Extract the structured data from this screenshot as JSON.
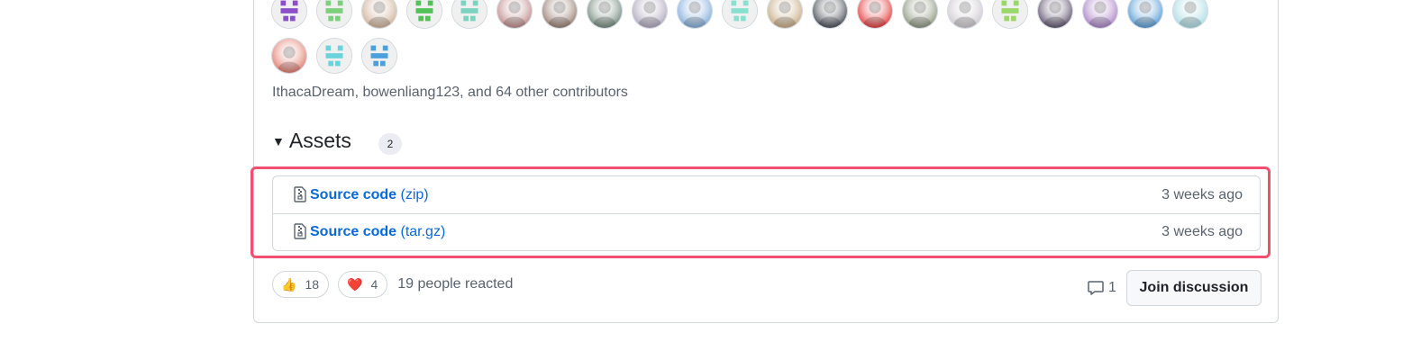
{
  "contributors": {
    "text": "IthacaDream, bowenliang123, and 64 other contributors",
    "avatars": [
      {
        "label": "purple-identicon",
        "color": "#8a4fc9"
      },
      {
        "label": "green-identicon",
        "color": "#7bd17b"
      },
      {
        "label": "photo-avatar",
        "color": "#c9a78a"
      },
      {
        "label": "green-identicon",
        "color": "#52c158"
      },
      {
        "label": "teal-identicon",
        "color": "#7cd3c0"
      },
      {
        "label": "photo-avatar",
        "color": "#b87a7a"
      },
      {
        "label": "photo-avatar",
        "color": "#8b6c5c"
      },
      {
        "label": "photo-avatar",
        "color": "#5f7a6a"
      },
      {
        "label": "photo-avatar",
        "color": "#a59bb5"
      },
      {
        "label": "cartoon-avatar",
        "color": "#6fa1d6"
      },
      {
        "label": "teal-identicon",
        "color": "#8ae0d0"
      },
      {
        "label": "cat-avatar",
        "color": "#c0a070"
      },
      {
        "label": "person-avatar",
        "color": "#2f3540"
      },
      {
        "label": "red-mask-avatar",
        "color": "#e12020"
      },
      {
        "label": "photo-avatar",
        "color": "#7e8a6e"
      },
      {
        "label": "anime-avatar",
        "color": "#c7c1c9"
      },
      {
        "label": "green-identicon",
        "color": "#9ad86a"
      },
      {
        "label": "anime-avatar",
        "color": "#4a3a5a"
      },
      {
        "label": "sunset-avatar",
        "color": "#a070c0"
      },
      {
        "label": "astronaut-avatar",
        "color": "#3f8fd0"
      },
      {
        "label": "beach-avatar",
        "color": "#9fd8e0"
      },
      {
        "label": "morty-avatar",
        "color": "#e06a5a"
      },
      {
        "label": "cyan-identicon",
        "color": "#6ad3db"
      },
      {
        "label": "blue-identicon",
        "color": "#4aa0dc"
      }
    ]
  },
  "assets": {
    "title": "Assets",
    "count": "2",
    "items": [
      {
        "name": "Source code",
        "ext": "(zip)",
        "time": "3 weeks ago"
      },
      {
        "name": "Source code",
        "ext": "(tar.gz)",
        "time": "3 weeks ago"
      }
    ]
  },
  "reactions": {
    "thumbs_emoji": "👍",
    "thumbs_count": "18",
    "heart_emoji": "❤️",
    "heart_count": "4",
    "summary": "19 people reacted"
  },
  "discussion": {
    "comment_count": "1",
    "join_label": "Join discussion"
  },
  "colors": {
    "link": "#0969da",
    "highlight": "#f0506e",
    "muted": "#59636e"
  }
}
